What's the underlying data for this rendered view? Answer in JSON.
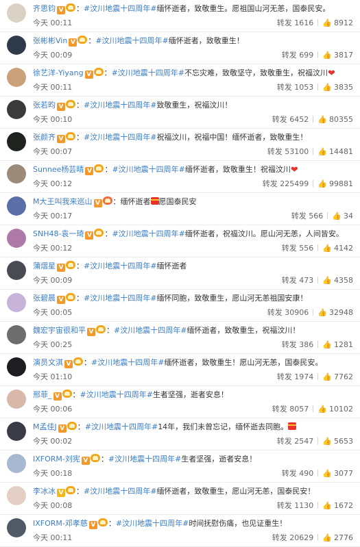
{
  "repost_label": "转发",
  "comments": [
    {
      "user": "齐思钧",
      "badge": "orange",
      "vip": "gold",
      "tag": "#汶川地震十四周年#",
      "text": "缅怀逝者，致敬重生。愿祖国山河无恙，国泰民安。",
      "suffix": "",
      "time": "今天 00:11",
      "reposts": "1616",
      "likes": "8912",
      "avatar_color": "#d9d2c2"
    },
    {
      "user": "张彬彬Vin",
      "badge": "orange",
      "vip": "gold",
      "tag": "#汶川地震十四周年#",
      "text": "缅怀逝者，致敬重生！",
      "suffix": "",
      "time": "今天 00:09",
      "reposts": "699",
      "likes": "3817",
      "avatar_color": "#2f3a4a"
    },
    {
      "user": "徐艺洋-Yiyang",
      "badge": "orange",
      "vip": "gold",
      "tag": "#汶川地震十四周年#",
      "text": "不忘灾难，致敬坚守，致敬重生，祝福汶川",
      "suffix": "heart",
      "time": "今天 00:11",
      "reposts": "1053",
      "likes": "3835",
      "avatar_color": "#c9a27c"
    },
    {
      "user": "张若昀",
      "badge": "orange",
      "vip": "gold",
      "tag": "#汶川地震十四周年#",
      "text": "致敬重生，祝福汶川！",
      "suffix": "",
      "time": "今天 00:10",
      "reposts": "6452",
      "likes": "80355",
      "avatar_color": "#3a3a3a"
    },
    {
      "user": "张颜齐",
      "badge": "orange",
      "vip": "gold",
      "tag": "#汶川地震十四周年#",
      "text": "祝福汶川，祝福中国！缅怀逝者，致敬重生！",
      "suffix": "",
      "time": "今天 00:07",
      "reposts": "53100",
      "likes": "14481",
      "avatar_color": "#1f2420"
    },
    {
      "user": "Sunnee杨芸晴",
      "badge": "orange",
      "vip": "gold",
      "tag": "#汶川地震十四周年#",
      "text": "缅怀逝者，致敬重生！祝福汶川",
      "suffix": "heart",
      "time": "今天 00:12",
      "reposts": "225499",
      "likes": "99881",
      "avatar_color": "#9c8a7a"
    },
    {
      "user": "M大王叫我来巡山",
      "badge": "orange",
      "vip": "red",
      "tag": "",
      "text": "缅怀逝者",
      "suffix": "gift",
      "after": "愿国泰民安",
      "time": "今天 00:17",
      "reposts": "566",
      "likes": "34",
      "avatar_color": "#5b6ea8"
    },
    {
      "user": "SNH48-袁一琦",
      "badge": "orange",
      "vip": "gold",
      "tag": "#汶川地震十四周年#",
      "text": "缅怀逝者，祝福汶川。愿山河无恙，人间皆安。",
      "suffix": "",
      "time": "今天 00:12",
      "reposts": "556",
      "likes": "4142",
      "avatar_color": "#b07aa8"
    },
    {
      "user": "蒲熠星",
      "badge": "orange",
      "vip": "gold",
      "tag": "#汶川地震十四周年#",
      "text": "缅怀逝者",
      "suffix": "",
      "time": "今天 00:09",
      "reposts": "473",
      "likes": "4358",
      "avatar_color": "#4a4a52"
    },
    {
      "user": "张碧晨",
      "badge": "orange",
      "vip": "gold",
      "tag": "#汶川地震十四周年#",
      "text": "缅怀同胞，致敬重生，愿山河无恙祖国安康！",
      "suffix": "",
      "time": "今天 00:05",
      "reposts": "30906",
      "likes": "32948",
      "avatar_color": "#c7b3d8"
    },
    {
      "user": "魏宏宇宙很和平",
      "badge": "orange",
      "vip": "gold",
      "tag": "#汶川地震十四周年#",
      "text": "缅怀逝者，致敬重生，祝福汶川！",
      "suffix": "",
      "time": "今天 00:25",
      "reposts": "386",
      "likes": "1281",
      "avatar_color": "#6d6d6d"
    },
    {
      "user": "演员文淇",
      "badge": "orange",
      "vip": "gold",
      "tag": "#汶川地震十四周年#",
      "text": "缅怀逝者，致敬重生！愿山河无恙，国泰民安。",
      "suffix": "",
      "time": "今天 01:10",
      "reposts": "1974",
      "likes": "7762",
      "avatar_color": "#1d1d22"
    },
    {
      "user": "邢菲_",
      "badge": "orange",
      "vip": "gold",
      "tag": "#汶川地震十四周年#",
      "text": "生者坚强，逝者安息！",
      "suffix": "",
      "time": "今天 00:06",
      "reposts": "8057",
      "likes": "10102",
      "avatar_color": "#d8b8a8"
    },
    {
      "user": "M孟佳J",
      "badge": "orange",
      "vip": "gold",
      "tag": "#汶川地震十四周年#",
      "text": "14年，我们未曾忘记，缅怀逝去同胞。",
      "suffix": "gift",
      "time": "今天 00:02",
      "reposts": "2547",
      "likes": "5653",
      "avatar_color": "#3b3b48"
    },
    {
      "user": "IXFORM-刘宪",
      "badge": "orange",
      "vip": "gold",
      "tag": "#汶川地震十四周年#",
      "text": "生者坚强，逝者安息！",
      "suffix": "",
      "time": "今天 00:18",
      "reposts": "490",
      "likes": "3077",
      "avatar_color": "#a8b8d0"
    },
    {
      "user": "李冰冰",
      "badge": "gold",
      "vip": "gold",
      "tag": "#汶川地震十四周年#",
      "text": "缅怀逝者，致敬重生，愿山河无恙，国泰民安！",
      "suffix": "",
      "time": "今天 00:08",
      "reposts": "1130",
      "likes": "1672",
      "avatar_color": "#e3cfc4"
    },
    {
      "user": "IXFORM-邓孝慈",
      "badge": "orange",
      "vip": "gold",
      "tag": "#汶川地震十四周年#",
      "text": "时间抚慰伤痛，也见证重生！",
      "suffix": "",
      "time": "今天 00:11",
      "reposts": "20629",
      "likes": "2776",
      "avatar_color": "#4f5a66"
    }
  ]
}
